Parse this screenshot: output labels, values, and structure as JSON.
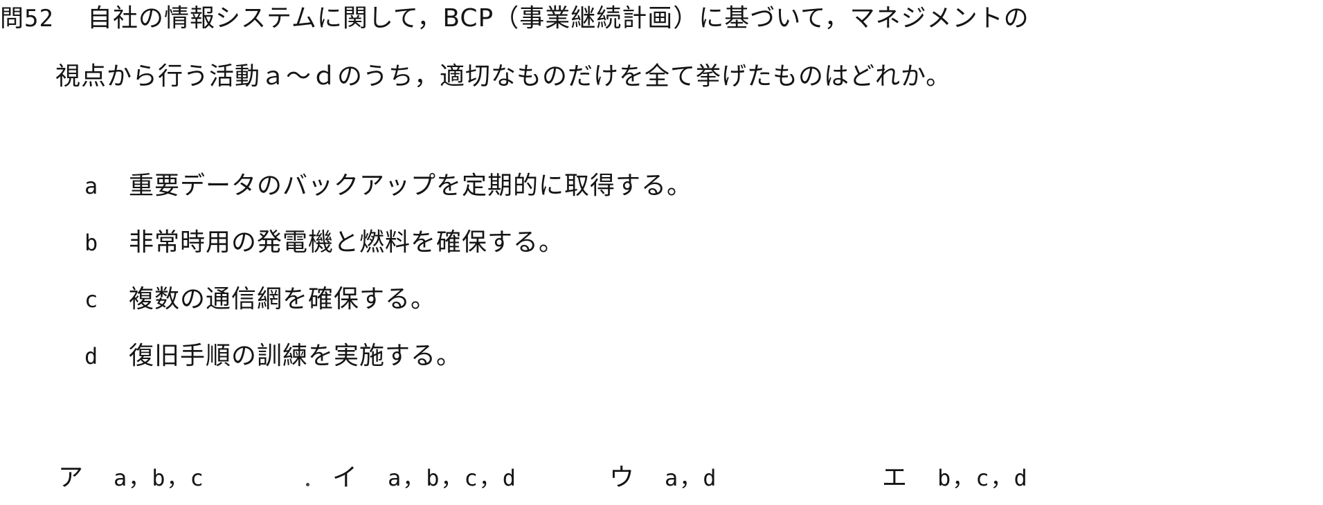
{
  "question": {
    "number": "問52",
    "line1": "自社の情報システムに関して，BCP（事業継続計画）に基づいて，マネジメントの",
    "line2": "視点から行う活動ａ～ｄのうち，適切なものだけを全て挙げたものはどれか。"
  },
  "items": [
    {
      "label": "a",
      "text": "重要データのバックアップを定期的に取得する。"
    },
    {
      "label": "b",
      "text": "非常時用の発電機と燃料を確保する。"
    },
    {
      "label": "c",
      "text": "複数の通信網を確保する。"
    },
    {
      "label": "d",
      "text": "復旧手順の訓練を実施する。"
    }
  ],
  "choices": [
    {
      "label": "ア",
      "value": "a，b，c"
    },
    {
      "label": "イ",
      "value": "a，b，c，d"
    },
    {
      "label": "ウ",
      "value": "a，d"
    },
    {
      "label": "エ",
      "value": "b，c，d"
    }
  ]
}
